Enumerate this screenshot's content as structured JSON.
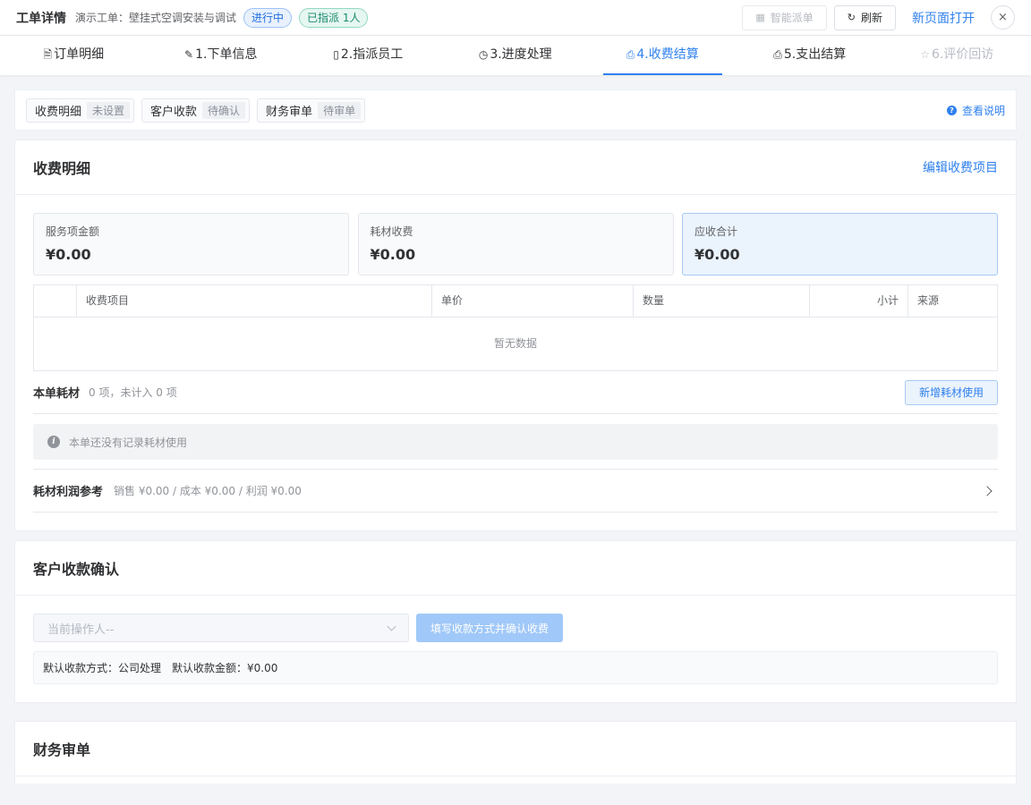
{
  "header": {
    "title": "工单详情",
    "subtitle": "演示工单：壁挂式空调安装与调试",
    "tags": [
      "进行中",
      "已指派 1人"
    ],
    "btn_dispatch": "智能派单",
    "btn_refresh": "刷新",
    "link_open": "新页面打开",
    "close": "×"
  },
  "tabs": [
    {
      "icon": "🗎",
      "label": "订单明细"
    },
    {
      "icon": "✎",
      "label": "1.下单信息"
    },
    {
      "icon": "▯",
      "label": "2.指派员工"
    },
    {
      "icon": "◷",
      "label": "3.进度处理"
    },
    {
      "icon": "⎙",
      "label": "4.收费结算"
    },
    {
      "icon": "⎙",
      "label": "5.支出结算"
    },
    {
      "icon": "☆",
      "label": "6.评价回访"
    }
  ],
  "status": {
    "chips": [
      {
        "label": "收费明细",
        "state": "未设置"
      },
      {
        "label": "客户收款",
        "state": "待确认"
      },
      {
        "label": "财务审单",
        "state": "待审单"
      }
    ],
    "help": "查看说明"
  },
  "charge": {
    "title": "收费明细",
    "edit": "编辑收费项目",
    "summary": [
      {
        "label": "服务项金额",
        "value": "¥0.00"
      },
      {
        "label": "耗材收费",
        "value": "¥0.00"
      },
      {
        "label": "应收合计",
        "value": "¥0.00"
      }
    ],
    "columns": [
      "",
      "收费项目",
      "单价",
      "数量",
      "小计",
      "来源"
    ],
    "empty": "暂无数据",
    "materials_title": "本单耗材",
    "materials_sub": "0 项，未计入 0 项",
    "add_material": "新增耗材使用",
    "info": "本单还没有记录耗材使用",
    "profit_title": "耗材利润参考",
    "profit_sub": "销售 ¥0.00 / 成本 ¥0.00 / 利润 ¥0.00"
  },
  "payment": {
    "title": "客户收款确认",
    "operator_placeholder": "当前操作人--",
    "confirm": "填写收款方式并确认收费",
    "default_method": "默认收款方式：公司处理",
    "default_amount": "默认收款金额：¥0.00"
  },
  "finance": {
    "title": "财务审单"
  }
}
